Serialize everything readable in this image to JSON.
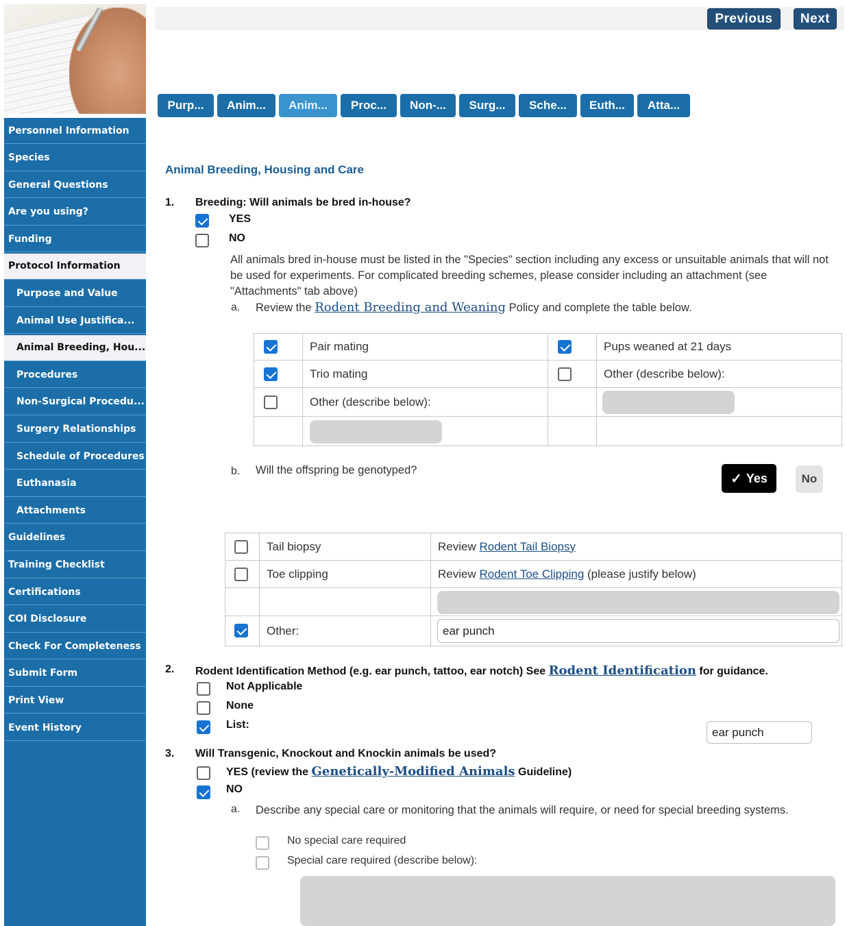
{
  "sidebar": {
    "items": [
      {
        "label": "Personnel Information"
      },
      {
        "label": "Species"
      },
      {
        "label": "General Questions"
      },
      {
        "label": "Are you using?"
      },
      {
        "label": "Funding"
      },
      {
        "label": "Protocol Information"
      },
      {
        "label": "Purpose and Value"
      },
      {
        "label": "Animal Use Justifica..."
      },
      {
        "label": "Animal Breeding, Hou..."
      },
      {
        "label": "Procedures"
      },
      {
        "label": "Non-Surgical Procedu..."
      },
      {
        "label": "Surgery Relationships"
      },
      {
        "label": "Schedule of Procedures"
      },
      {
        "label": "Euthanasia"
      },
      {
        "label": "Attachments"
      },
      {
        "label": "Guidelines"
      },
      {
        "label": "Training Checklist"
      },
      {
        "label": "Certifications"
      },
      {
        "label": "COI Disclosure"
      },
      {
        "label": "Check For Completeness"
      },
      {
        "label": "Submit Form"
      },
      {
        "label": "Print View"
      },
      {
        "label": "Event History"
      }
    ]
  },
  "header": {
    "previous": "Previous",
    "next": "Next"
  },
  "tabs": [
    "Purp...",
    "Anim...",
    "Anim...",
    "Proc...",
    "Non-...",
    "Surg...",
    "Sche...",
    "Euth...",
    "Atta..."
  ],
  "page": {
    "title": "Animal Breeding, Housing and Care",
    "q1": {
      "num": "1.",
      "text": "Breeding: Will animals be bred in-house?",
      "yes": "YES",
      "no": "NO",
      "note": "All animals bred in-house must be listed in the \"Species\" section including any excess or unsuitable animals that will not be used for experiments. For complicated breeding schemes, please consider including an attachment (see \"Attachments\" tab above)",
      "a_letter": "a.",
      "a_pre": "Review the",
      "a_link": "Rodent Breeding and Weaning",
      "a_post": "Policy and complete the table below.",
      "table": {
        "pair": "Pair mating",
        "trio": "Trio mating",
        "other_left": "Other (describe below):",
        "weaned": "Pups weaned at 21 days",
        "other_right": "Other (describe below):"
      },
      "b_letter": "b.",
      "b_text": "Will the offspring be genotyped?",
      "b_yes": "Yes",
      "b_no": "No",
      "geno": {
        "tail": "Tail biopsy",
        "tail_review": "Review",
        "tail_link": "Rodent Tail Biopsy",
        "toe": "Toe clipping",
        "toe_review": "Review",
        "toe_link": "Rodent Toe Clipping",
        "toe_post": "(please justify below)",
        "other": "Other:",
        "other_value": "ear punch"
      }
    },
    "q2": {
      "num": "2.",
      "text": "Rodent Identification Method (e.g. ear punch, tattoo, ear notch) See",
      "link": "Rodent Identification",
      "post": "for guidance.",
      "na": "Not Applicable",
      "none": "None",
      "list": "List:",
      "list_value": "ear punch"
    },
    "q3": {
      "num": "3.",
      "text": "Will Transgenic, Knockout and Knockin animals be used?",
      "yes_pre": "YES (review the",
      "yes_link": "Genetically-Modified Animals",
      "yes_post": "Guideline)",
      "no": "NO",
      "a_letter": "a.",
      "a_text": "Describe any special care or monitoring that the animals will require, or need for special breeding systems.",
      "no_special": "No special care required",
      "special": "Special care required (describe below):"
    }
  },
  "colors": {
    "nav": "#1b6ea8",
    "nav_active_tab": "#3a93cc",
    "header_btn": "#23507a",
    "checkbox": "#1673d2",
    "title": "#1a5d94"
  }
}
